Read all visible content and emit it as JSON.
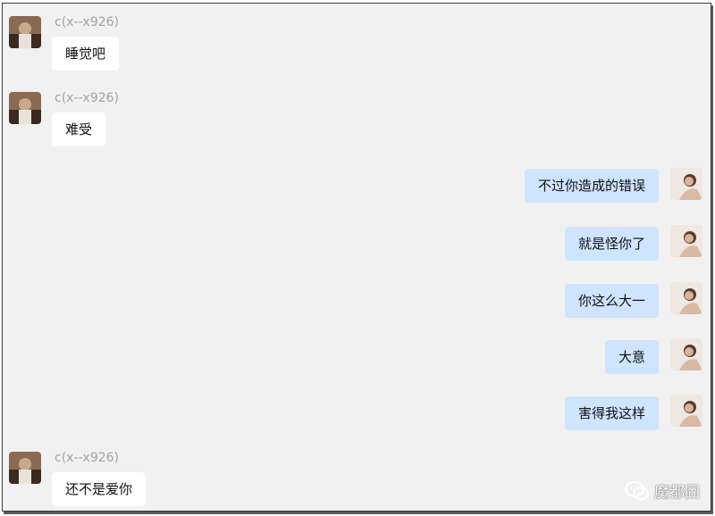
{
  "chat": {
    "contact_name": "c(x--x926)",
    "messages": [
      {
        "side": "in",
        "text": "睡觉吧"
      },
      {
        "side": "in",
        "text": "难受"
      },
      {
        "side": "out",
        "text": "不过你造成的错误"
      },
      {
        "side": "out",
        "text": "就是怪你了"
      },
      {
        "side": "out",
        "text": "你这么大一"
      },
      {
        "side": "out",
        "text": "大意"
      },
      {
        "side": "out",
        "text": "害得我这样"
      },
      {
        "side": "in",
        "text": "还不是爱你"
      }
    ]
  },
  "watermark": {
    "icon": "wechat-icon",
    "text": "魔都囧"
  },
  "colors": {
    "background": "#f1f1f1",
    "incoming_bubble": "#ffffff",
    "outgoing_bubble": "#cfe4ff",
    "sender_name": "#a2a2a2"
  }
}
